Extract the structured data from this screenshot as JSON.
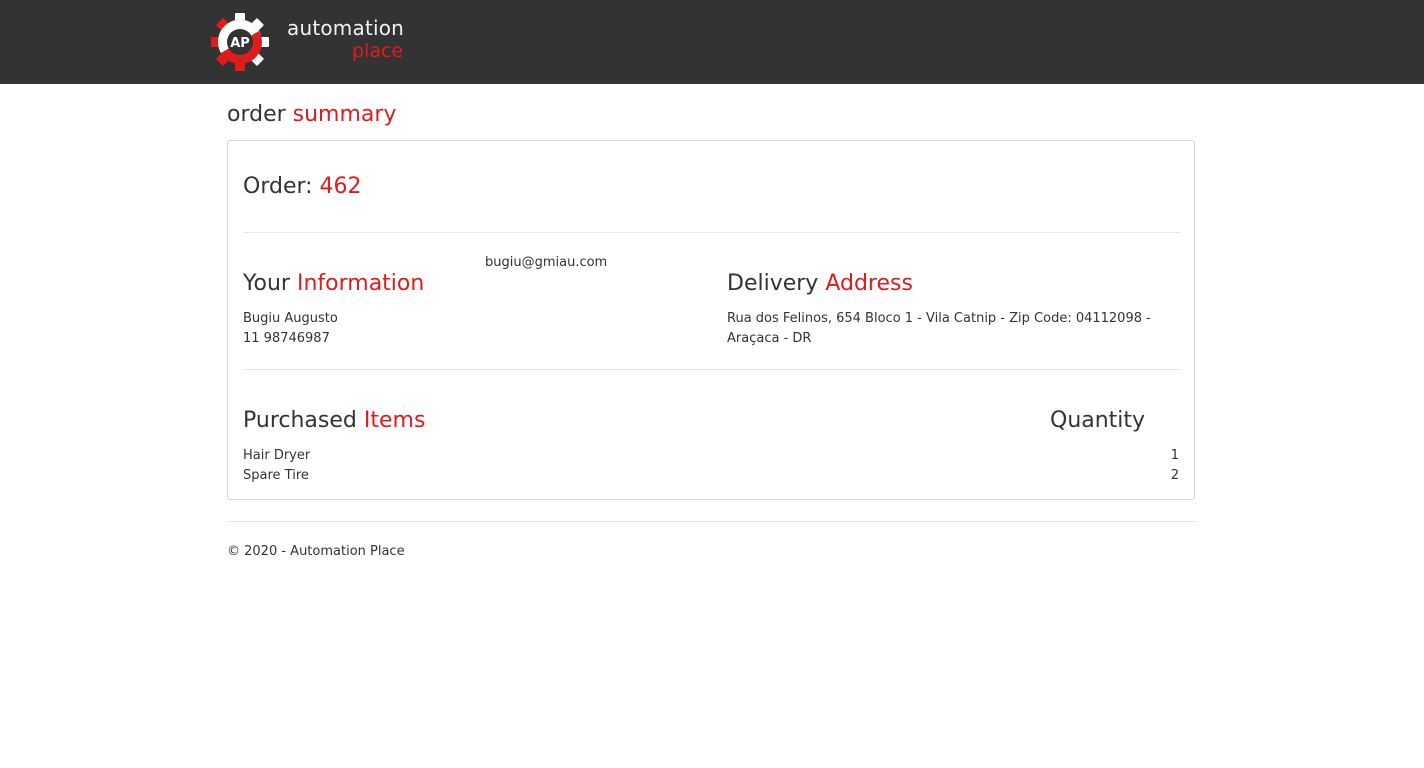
{
  "header": {
    "logo_badge": "AP",
    "logo_line1": "automation",
    "logo_line2": "place",
    "brand_color": "#e01b1b",
    "navbar_color": "#333333"
  },
  "page": {
    "title_plain": "order ",
    "title_accent": "summary"
  },
  "order": {
    "label": "Order: ",
    "number": "462"
  },
  "customer": {
    "email": "bugiu@gmiau.com",
    "heading_plain": "Your ",
    "heading_accent": "Information",
    "name": "Bugiu Augusto",
    "phone": "11 98746987"
  },
  "delivery": {
    "heading_plain": "Delivery ",
    "heading_accent": "Address",
    "address_line1": "Rua dos Felinos, 654 Bloco 1 - Vila Catnip - Zip Code: 04112098 -",
    "address_line2": "Araçaca - DR"
  },
  "items": {
    "heading_plain": "Purchased ",
    "heading_accent": "Items",
    "quantity_heading": "Quantity",
    "list": [
      {
        "name": "Hair Dryer",
        "quantity": "1"
      },
      {
        "name": "Spare Tire",
        "quantity": "2"
      }
    ]
  },
  "footer": {
    "copyright": "© 2020 - Automation Place"
  }
}
